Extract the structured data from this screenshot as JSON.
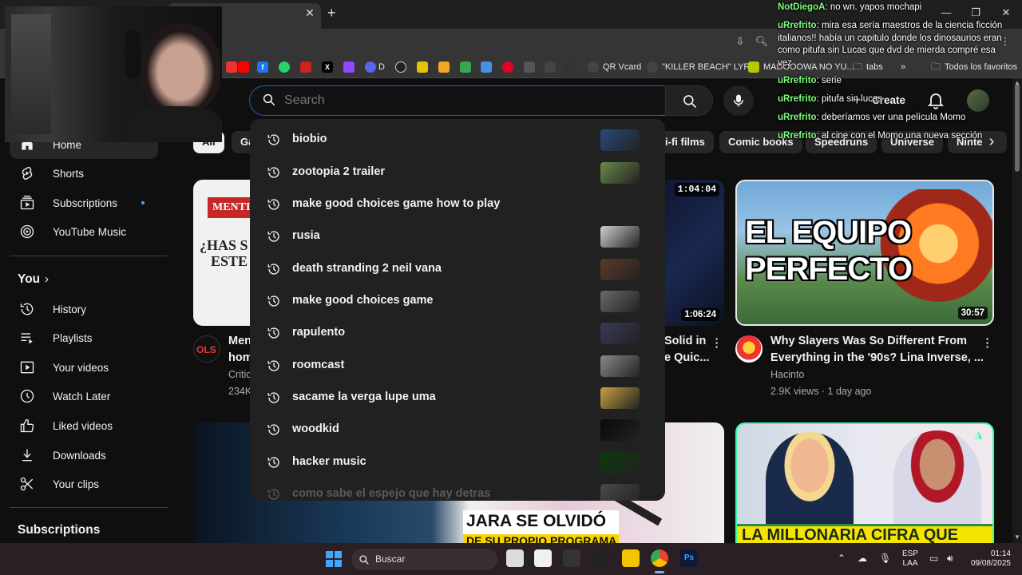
{
  "browser": {
    "window_controls": {
      "minimize": "—",
      "maximize": "❐",
      "close": "✕"
    },
    "bookmarks": [
      {
        "label": "D",
        "color": "#5865f2"
      },
      {
        "label": "QR Vcard",
        "color": "#333"
      },
      {
        "label": "\"KILLER BEACH\" LYR...",
        "color": "#333"
      },
      {
        "label": "MADOOOWA NO YU...",
        "color": "#b5c800"
      },
      {
        "label": "tabs",
        "color": "#333"
      },
      {
        "label": "»",
        "color": ""
      },
      {
        "label": "Todos los favoritos",
        "color": "#333"
      }
    ]
  },
  "header": {
    "search_placeholder": "Search",
    "create_label": "Create"
  },
  "sidebar": {
    "items": [
      {
        "label": "Home",
        "icon": "home-icon"
      },
      {
        "label": "Shorts",
        "icon": "shorts-icon"
      },
      {
        "label": "Subscriptions",
        "icon": "subscriptions-icon"
      },
      {
        "label": "YouTube Music",
        "icon": "music-icon"
      }
    ],
    "you_heading": "You",
    "you_items": [
      {
        "label": "History",
        "icon": "history-icon"
      },
      {
        "label": "Playlists",
        "icon": "playlists-icon"
      },
      {
        "label": "Your videos",
        "icon": "your-videos-icon"
      },
      {
        "label": "Watch Later",
        "icon": "watch-later-icon"
      },
      {
        "label": "Liked videos",
        "icon": "like-icon"
      },
      {
        "label": "Downloads",
        "icon": "download-icon"
      },
      {
        "label": "Your clips",
        "icon": "scissors-icon"
      }
    ],
    "subscriptions_heading": "Subscriptions"
  },
  "chips": [
    {
      "label": "All",
      "selected": true
    },
    {
      "label": "Ga",
      "selected": false
    },
    {
      "label": "i-fi films",
      "selected": false
    },
    {
      "label": "Comic books",
      "selected": false
    },
    {
      "label": "Speedruns",
      "selected": false
    },
    {
      "label": "Universe",
      "selected": false
    },
    {
      "label": "Ninte",
      "selected": false
    }
  ],
  "videos": [
    {
      "title_line1": "Men",
      "title_line2": "hom",
      "channel": "Critic",
      "meta": "234K",
      "thumb_text1": "MENTI",
      "thumb_text2": "¿HAS S",
      "thumb_text3": "ESTE",
      "avatar_text": "OLS"
    },
    {
      "title_line1": "Solid in",
      "title_line2": "e Quic...",
      "duration_top": "1:04:04",
      "duration": "1:06:24"
    },
    {
      "title_line1": "Why Slayers Was So Different From",
      "title_line2": "Everything in the '90s? Lina Inverse, ...",
      "channel": "Hacinto",
      "meta": "2.9K views · 1 day ago",
      "duration": "30:57",
      "thumb_text1": "EL EQUIPO",
      "thumb_text2": "PERFECTO"
    },
    {
      "banner_line1": "JARA SE OLVIDÓ",
      "banner_line2": "DE SU PROPIO PROGRAMA"
    },
    {
      "banner": "LA MILLONARIA CIFRA QUE"
    }
  ],
  "suggestions": [
    {
      "text": "biobio",
      "has_thumb": true,
      "thumb_color": "#2a4a7a"
    },
    {
      "text": "zootopia 2 trailer",
      "has_thumb": true,
      "thumb_color": "#6a8a4a"
    },
    {
      "text": "make good choices game how to play",
      "has_thumb": false,
      "thumb_color": ""
    },
    {
      "text": "rusia",
      "has_thumb": true,
      "thumb_color": "#cfcfcf"
    },
    {
      "text": "death stranding 2 neil vana",
      "has_thumb": true,
      "thumb_color": "#5a3a2a"
    },
    {
      "text": "make good choices game",
      "has_thumb": true,
      "thumb_color": "#6a6a6a"
    },
    {
      "text": "rapulento",
      "has_thumb": true,
      "thumb_color": "#3a3a5a"
    },
    {
      "text": "roomcast",
      "has_thumb": true,
      "thumb_color": "#8a8a8a"
    },
    {
      "text": "sacame la verga lupe uma",
      "has_thumb": true,
      "thumb_color": "#c8a040"
    },
    {
      "text": "woodkid",
      "has_thumb": true,
      "thumb_color": "#0a0a0a"
    },
    {
      "text": "hacker music",
      "has_thumb": true,
      "thumb_color": "#0a3a0a"
    },
    {
      "text": "como sabe el espejo que hay detras",
      "has_thumb": true,
      "thumb_color": "#4a4a4a"
    }
  ],
  "chat": [
    {
      "user": "NotDiegoA",
      "msg": "no wn. yapos mochapi"
    },
    {
      "user": "uRrefrito",
      "msg": "mira esa sería maestros de la ciencia ficción italianos!! había un capitulo donde los dinosaurios eran como pitufa sin Lucas que dvd de mierda compré esa vez"
    },
    {
      "user": "uRrefrito",
      "msg": "serie"
    },
    {
      "user": "uRrefrito",
      "msg": "pitufa sin lucas"
    },
    {
      "user": "uRrefrito",
      "msg": "deberíamos ver una película Momo"
    },
    {
      "user": "uRrefrito",
      "msg": "al cine con el Momo una nueva sección"
    }
  ],
  "taskbar": {
    "search_label": "Buscar",
    "lang_top": "ESP",
    "lang_bottom": "LAA",
    "time": "01:14",
    "date": "09/08/2025"
  }
}
